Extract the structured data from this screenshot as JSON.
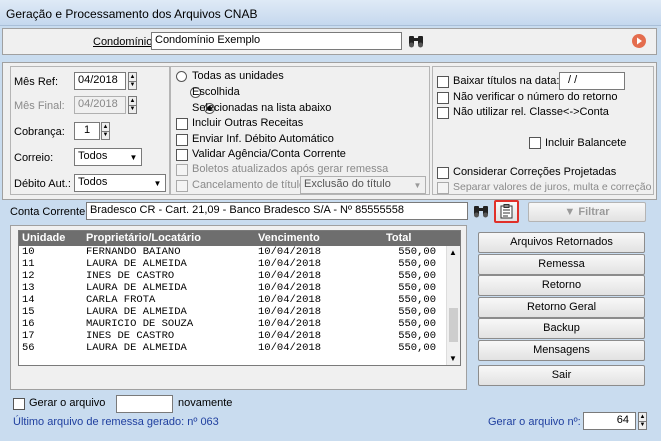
{
  "window": {
    "title": "Geração e Processamento dos Arquivos CNAB"
  },
  "condominio": {
    "label": "Condomínio:",
    "value": "Condomínio Exemplo"
  },
  "left": {
    "mes_ref_label": "Mês Ref:",
    "mes_ref": "04/2018",
    "mes_final_label": "Mês Final:",
    "mes_final": "04/2018",
    "cobranca_label": "Cobrança:",
    "cobranca": "1",
    "correio_label": "Correio:",
    "correio": "Todos",
    "debito_label": "Débito Aut.:",
    "debito": "Todos"
  },
  "middle": {
    "radio_todas": "Todas as unidades",
    "radio_escolhida": "Escolhida",
    "radio_selecionadas": "Selecionadas na lista abaixo",
    "incluir_receitas": "Incluir Outras Receitas",
    "enviar_debito": "Enviar Inf. Débito Automático",
    "validar_agencia": "Validar Agência/Conta Corrente",
    "boletos_atualizados": "Boletos atualizados após gerar remessa",
    "cancelamento_label": "Cancelamento de título",
    "cancelamento_value": "Exclusão do título"
  },
  "right": {
    "baixar_titulos": "Baixar títulos na data:",
    "baixar_date": "/ /",
    "nao_verificar": "Não verificar o número do retorno",
    "nao_utilizar": "Não utilizar rel. Classe<->Conta",
    "incluir_balancete": "Incluir Balancete",
    "considerar_correcoes": "Considerar Correções Projetadas",
    "separar_valores": "Separar valores de juros, multa e correção"
  },
  "conta": {
    "label": "Conta Corrente:",
    "value": "Bradesco CR - Cart. 21,09 - Banco Bradesco S/A - Nº 85555558",
    "filtrar": "Filtrar"
  },
  "grid": {
    "headers": [
      "Unidade",
      "Proprietário/Locatário",
      "Vencimento",
      "Total"
    ],
    "rows": [
      [
        "10",
        "FERNANDO BAIANO",
        "10/04/2018",
        "550,00"
      ],
      [
        "11",
        "LAURA DE ALMEIDA",
        "10/04/2018",
        "550,00"
      ],
      [
        "12",
        "INES DE CASTRO",
        "10/04/2018",
        "550,00"
      ],
      [
        "13",
        "LAURA DE ALMEIDA",
        "10/04/2018",
        "550,00"
      ],
      [
        "14",
        "CARLA FROTA",
        "10/04/2018",
        "550,00"
      ],
      [
        "15",
        "LAURA DE ALMEIDA",
        "10/04/2018",
        "550,00"
      ],
      [
        "16",
        "MAURICIO DE SOUZA",
        "10/04/2018",
        "550,00"
      ],
      [
        "17",
        "INES DE CASTRO",
        "10/04/2018",
        "550,00"
      ],
      [
        "56",
        "LAURA DE ALMEIDA",
        "10/04/2018",
        "550,00"
      ]
    ]
  },
  "actions": {
    "arquivos_retornados": "Arquivos Retornados",
    "remessa": "Remessa",
    "retorno": "Retorno",
    "retorno_geral": "Retorno Geral",
    "backup": "Backup",
    "mensagens": "Mensagens",
    "sair": "Sair"
  },
  "footer": {
    "gerar_arquivo": "Gerar o arquivo",
    "novamente": "novamente",
    "ultimo_arquivo": "Último arquivo de remessa gerado: nº 063",
    "gerar_num_label": "Gerar o arquivo nº:",
    "gerar_num": "64"
  },
  "colors": {
    "accent_blue": "#1f3f9f",
    "highlight_red": "#e0302a",
    "window_bg": "#c9dcef"
  }
}
